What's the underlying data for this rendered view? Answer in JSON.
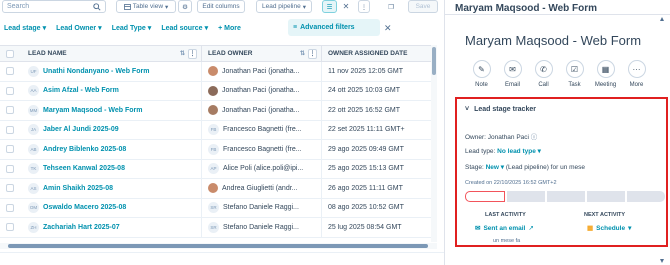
{
  "toolbar": {
    "search_placeholder": "Search",
    "table_view": "Table view",
    "edit_columns": "Edit columns",
    "lead_pipeline": "Lead pipeline",
    "save": "Save"
  },
  "filters": {
    "items": [
      "Lead stage",
      "Lead Owner",
      "Lead Type",
      "Lead source"
    ],
    "more": "+ More",
    "advanced": "Advanced filters"
  },
  "table": {
    "headers": {
      "name": "LEAD NAME",
      "owner": "LEAD OWNER",
      "date": "OWNER ASSIGNED DATE"
    },
    "rows": [
      {
        "logo": "UF",
        "name": "Unathi Nondanyano - Web Form",
        "owner": "Jonathan Paci (jonatha...",
        "owner_kind": "photo",
        "date": "11 nov 2025 12:05 GMT"
      },
      {
        "logo": "AA",
        "name": "Asim Afzal - Web Form",
        "owner": "Jonathan Paci (jonatha...",
        "owner_kind": "photo",
        "date": "24 ott 2025 10:03 GMT"
      },
      {
        "logo": "MM",
        "name": "Maryam Maqsood - Web Form",
        "owner": "Jonathan Paci (jonatha...",
        "owner_kind": "photo",
        "date": "22 ott 2025 16:52 GMT"
      },
      {
        "logo": "JA",
        "name": "Jaber Al Jundi 2025-09",
        "owner": "Francesco Bagnetti (fre...",
        "owner_kind": "FB",
        "date": "22 set 2025 11:11 GMT+"
      },
      {
        "logo": "AB",
        "name": "Andrey Biblenko 2025-08",
        "owner": "Francesco Bagnetti (fre...",
        "owner_kind": "FB",
        "date": "29 ago 2025 09:49 GMT"
      },
      {
        "logo": "TK",
        "name": "Tehseen Kanwal 2025-08",
        "owner": "Alice Poli (alice.poli@ipi...",
        "owner_kind": "AP",
        "date": "25 ago 2025 15:13 GMT"
      },
      {
        "logo": "AS",
        "name": "Amin Shaikh 2025-08",
        "owner": "Andrea Giuglietti (andr...",
        "owner_kind": "photo",
        "date": "26 ago 2025 11:11 GMT"
      },
      {
        "logo": "OM",
        "name": "Oswaldo Macero 2025-08",
        "owner": "Stefano Daniele Raggi...",
        "owner_kind": "SR",
        "date": "08 ago 2025 10:52 GMT"
      },
      {
        "logo": "ZH",
        "name": "Zachariah Hart 2025-07",
        "owner": "Stefano Daniele Raggi...",
        "owner_kind": "SR",
        "date": "25 lug 2025 08:54 GMT"
      }
    ]
  },
  "panel": {
    "header_title": "Maryam Maqsood - Web Form",
    "big_title": "Maryam Maqsood - Web Form",
    "actions": [
      "Note",
      "Email",
      "Call",
      "Task",
      "Meeting",
      "More"
    ],
    "tracker": {
      "title": "Lead stage tracker",
      "owner_label": "Owner:",
      "owner_value": "Jonathan Paci",
      "type_label": "Lead type:",
      "type_value": "No lead type",
      "stage_label": "Stage:",
      "stage_value": "New",
      "stage_suffix": "(Lead pipeline) for un mese",
      "created": "Created on 22/10/2025 16:52 GMT+2",
      "last_activity_h": "LAST ACTIVITY",
      "last_activity_v": "Sent an email",
      "last_activity_sub": "un mese fa",
      "next_activity_h": "NEXT ACTIVITY",
      "next_activity_v": "Schedule"
    }
  },
  "colors": {
    "accent": "#0091ae",
    "highlight_border": "#e02020",
    "stage_current": "#f2545b"
  }
}
